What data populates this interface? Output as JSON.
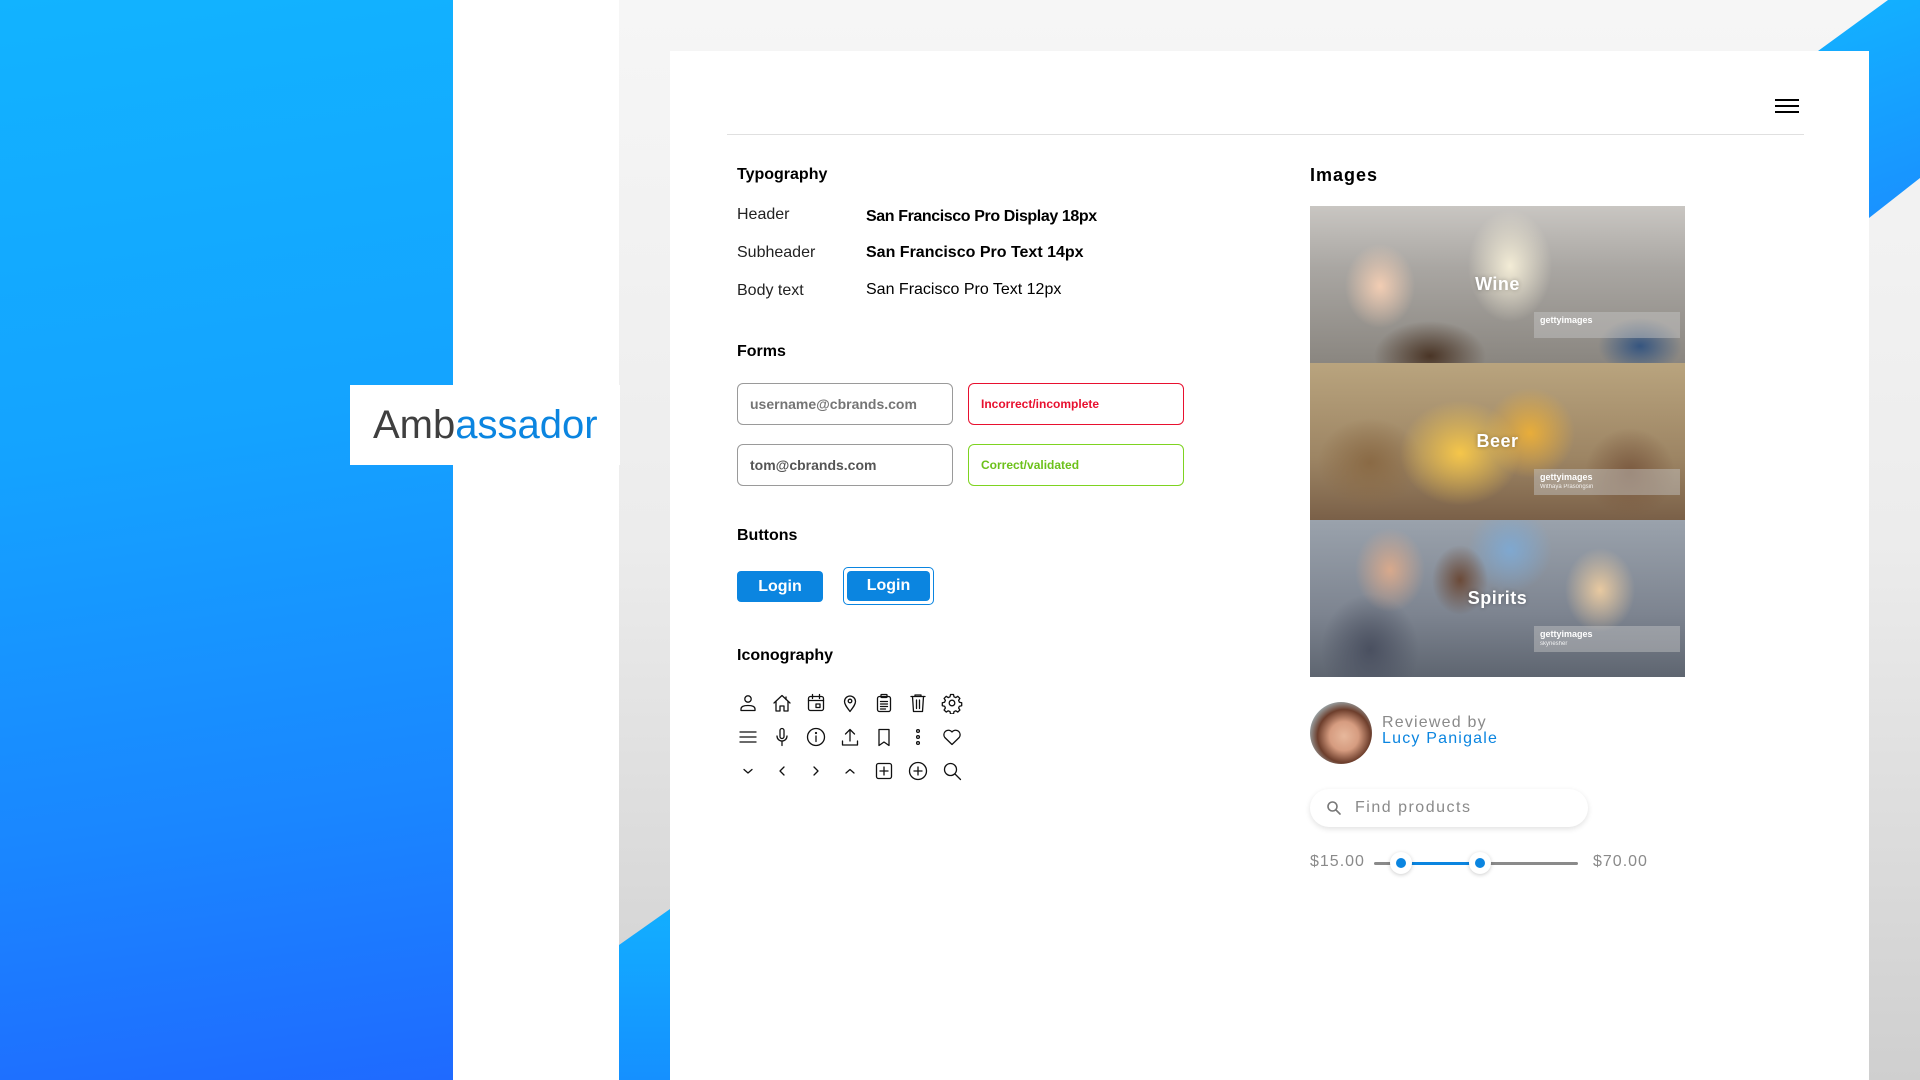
{
  "brand": {
    "logo_part1": "Amb",
    "logo_part2": "assador",
    "accent_color": "#0b85e0"
  },
  "header": {
    "menu_icon": "hamburger-menu-icon"
  },
  "typography": {
    "title": "Typography",
    "rows": [
      {
        "label": "Header",
        "value": "San Francisco Pro Display 18px"
      },
      {
        "label": "Subheader",
        "value": "San Francisco Pro Text 14px"
      },
      {
        "label": "Body text",
        "value": "San Fracisco Pro Text 12px"
      }
    ]
  },
  "forms": {
    "title": "Forms",
    "fields": [
      {
        "state": "empty",
        "value": "",
        "placeholder": "username@cbrands.com"
      },
      {
        "state": "error",
        "value": "Incorrect/incomplete",
        "color": "#e8102f"
      },
      {
        "state": "filled",
        "value": "tom@cbrands.com"
      },
      {
        "state": "valid",
        "value": "Correct/validated",
        "color": "#7ed321"
      }
    ]
  },
  "buttons": {
    "title": "Buttons",
    "items": [
      {
        "label": "Login",
        "state": "default"
      },
      {
        "label": "Login",
        "state": "focused"
      }
    ]
  },
  "iconography": {
    "title": "Iconography",
    "icons": [
      [
        "user",
        "home",
        "calendar",
        "location-pin",
        "clipboard",
        "trash",
        "settings"
      ],
      [
        "menu",
        "microphone",
        "info",
        "upload",
        "bookmark",
        "more-vertical",
        "heart"
      ],
      [
        "chevron-down",
        "chevron-left",
        "chevron-right",
        "chevron-up",
        "add-square",
        "add-circle",
        "search"
      ]
    ]
  },
  "images": {
    "title": "Images",
    "tiles": [
      {
        "label": "Wine",
        "credit_brand": "gettyimages",
        "credit_author": ""
      },
      {
        "label": "Beer",
        "credit_brand": "gettyimages",
        "credit_author": "Withaya Prasongsin"
      },
      {
        "label": "Spirits",
        "credit_brand": "gettyimages",
        "credit_author": "skynesher"
      }
    ]
  },
  "review": {
    "prefix": "Reviewed by",
    "name": "Lucy Panigale"
  },
  "search": {
    "placeholder": "Find products",
    "value": ""
  },
  "price_range": {
    "min_label": "$15.00",
    "max_label": "$70.00",
    "low_fraction": 0.13,
    "high_fraction": 0.52
  }
}
